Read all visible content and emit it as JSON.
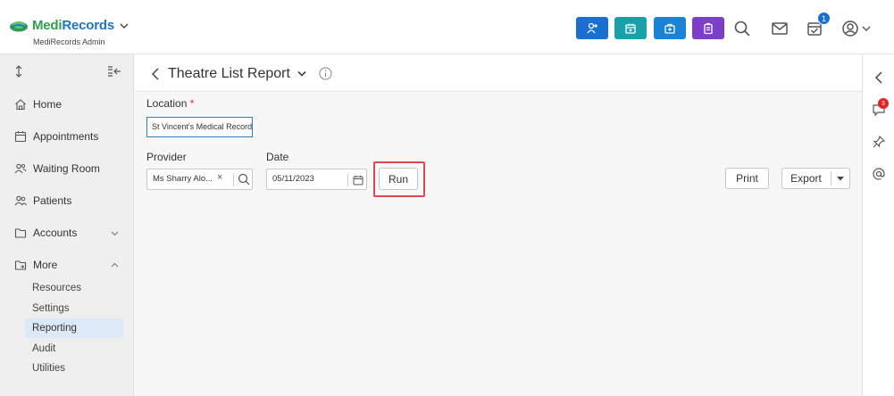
{
  "brand": {
    "name_part1": "Medi",
    "name_part2": "Records",
    "subtitle": "MediRecords Admin",
    "accent": "#1d74c8",
    "accent2": "#2e9f4a"
  },
  "topbar": {
    "quick_buttons": [
      {
        "icon": "add-patient-icon",
        "color": "#1b6fd1"
      },
      {
        "icon": "calendar-icon",
        "color": "#1aa0a8"
      },
      {
        "icon": "medical-kit-icon",
        "color": "#1b82d8"
      },
      {
        "icon": "clipboard-icon",
        "color": "#7b3fc9"
      }
    ],
    "tasks_badge": "1"
  },
  "sidebar": {
    "items": [
      {
        "label": "Home",
        "icon": "home-icon"
      },
      {
        "label": "Appointments",
        "icon": "calendar-icon"
      },
      {
        "label": "Waiting Room",
        "icon": "people-icon"
      },
      {
        "label": "Patients",
        "icon": "patients-icon"
      },
      {
        "label": "Accounts",
        "icon": "folder-icon"
      },
      {
        "label": "More",
        "icon": "folder-share-icon"
      }
    ],
    "sub_items": [
      {
        "label": "Resources"
      },
      {
        "label": "Settings"
      },
      {
        "label": "Reporting",
        "active": true
      },
      {
        "label": "Audit"
      },
      {
        "label": "Utilities"
      }
    ]
  },
  "rail": {
    "comments_badge": "3"
  },
  "page": {
    "title": "Theatre List Report"
  },
  "form": {
    "location_label": "Location",
    "required_mark": "*",
    "location_value": "St Vincent's Medical Records",
    "provider_label": "Provider",
    "provider_value": "Ms Sharry Alo...",
    "provider_clear": "×",
    "date_label": "Date",
    "date_value": "05/11/2023"
  },
  "actions": {
    "run_label": "Run",
    "print_label": "Print",
    "export_label": "Export"
  }
}
